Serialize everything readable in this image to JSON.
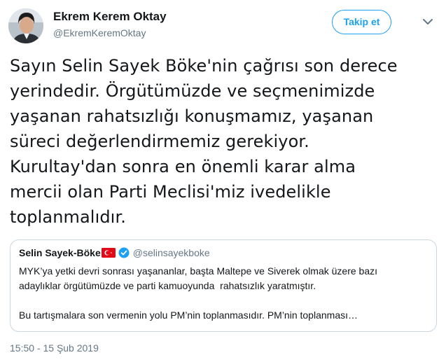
{
  "author": {
    "display_name": "Ekrem Kerem Oktay",
    "handle": "@EkremKeremOktay",
    "avatar_icon": "profile-photo"
  },
  "actions": {
    "follow_label": "Takip et",
    "menu_icon": "chevron-down-icon"
  },
  "tweet": {
    "text_lines": [
      "Sayın Selin Sayek Böke'nin çağrısı son derece",
      "yerindedir. Örgütümüzde ve seçmenimizde",
      "yaşanan rahatsızlığı konuşmamız, yaşanan",
      "süreci değerlendirmemiz gerekiyor.",
      "Kurultay'dan sonra en önemli karar alma",
      "mercii olan Parti Meclisi'miz ivedelikle",
      "toplanmalıdır."
    ],
    "timestamp": "15:50 - 15 Şub 2019"
  },
  "quote": {
    "name": "Selin Sayek-Böke",
    "handle": "@selinsayekboke",
    "flag_icon": "turkey-flag-emoji",
    "verified_icon": "verified-badge-icon",
    "lines": [
      "MYK’ya yetki devri sonrası yaşananlar, başta Maltepe ve Siverek olmak üzere bazı",
      "adaylıklar örgütümüzde ve parti kamuoyunda  rahatsızlık yaratmıştır.",
      "Bu tartışmalara son vermenin yolu PM’nin toplanmasıdır. PM’nin toplanması…"
    ]
  },
  "colors": {
    "accent": "#1da1f2",
    "muted": "#657786",
    "border": "#ccd6dd",
    "text": "#14171a"
  }
}
